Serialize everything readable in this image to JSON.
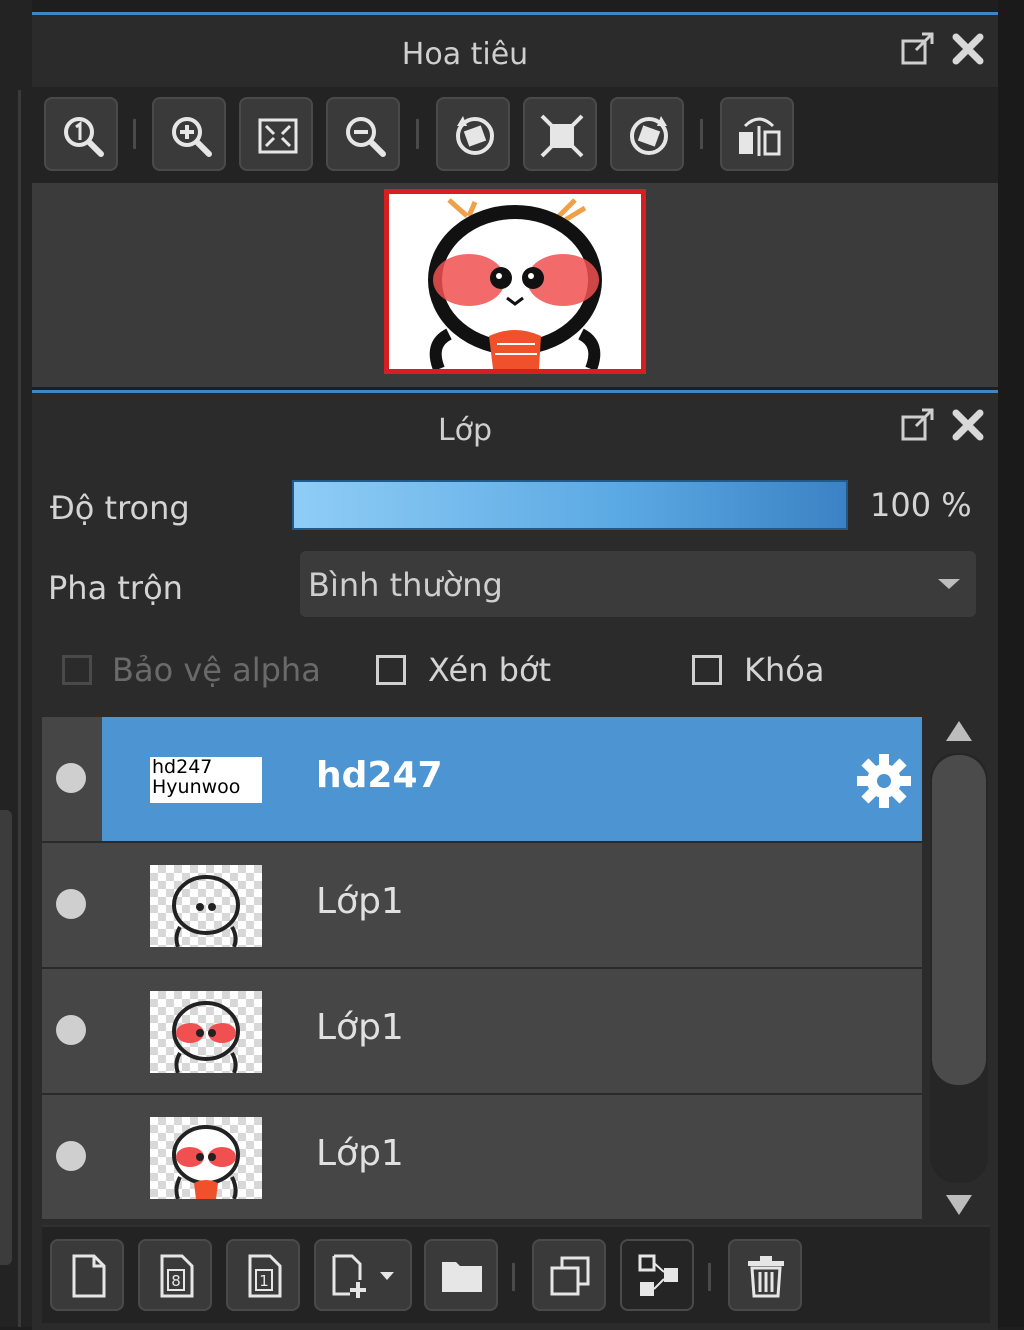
{
  "navigator": {
    "title": "Hoa tiêu",
    "header_icons": [
      "popout-icon",
      "close-icon"
    ],
    "toolbar": [
      "zoom-actual-icon",
      "zoom-in-icon",
      "fit-window-icon",
      "zoom-out-icon",
      "rotate-left-icon",
      "fullscreen-icon",
      "rotate-right-icon",
      "flip-icon"
    ]
  },
  "layers": {
    "title": "Lớp",
    "opacity_label": "Độ trong",
    "opacity_value": "100 %",
    "opacity": 1.0,
    "blend_label": "Pha trộn",
    "blend_value": "Bình thường",
    "options": [
      {
        "label": "Bảo vệ alpha",
        "checked": false,
        "enabled": false
      },
      {
        "label": "Xén bớt",
        "checked": false,
        "enabled": true
      },
      {
        "label": "Khóa",
        "checked": false,
        "enabled": true
      }
    ],
    "items": [
      {
        "name": "hd247",
        "thumb_text_line1": "hd247",
        "thumb_text_line2": "Hyunwoo",
        "selected": true
      },
      {
        "name": "Lớp1",
        "selected": false
      },
      {
        "name": "Lớp1",
        "selected": false
      },
      {
        "name": "Lớp1",
        "selected": false
      }
    ],
    "toolbar": [
      "new-layer-icon",
      "new-8bit-layer-icon",
      "new-1bit-layer-icon",
      "add-layer-dropdown-icon",
      "new-folder-icon",
      "duplicate-layer-icon",
      "merge-layer-icon",
      "delete-layer-icon"
    ]
  },
  "colors": {
    "accent": "#3f86c7",
    "selected_row": "#4c95d2",
    "preview_border": "#d81e1e"
  }
}
